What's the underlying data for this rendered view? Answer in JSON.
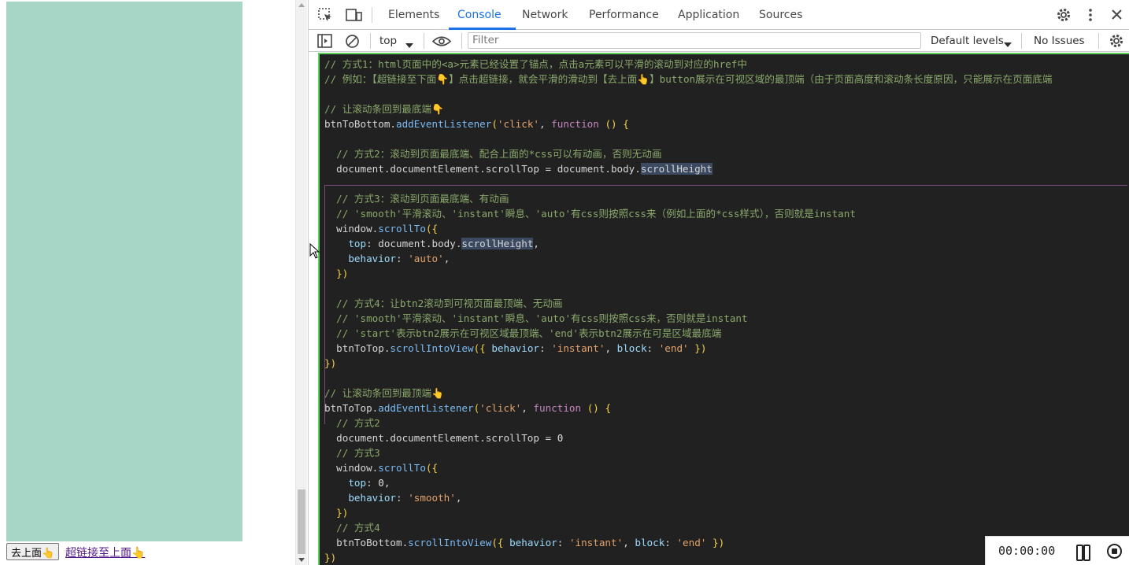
{
  "page": {
    "to_top_button": "去上面👆",
    "link_text": "超链接至上面👆"
  },
  "devtools": {
    "tabs": [
      {
        "label": "Elements"
      },
      {
        "label": "Console"
      },
      {
        "label": "Network"
      },
      {
        "label": "Performance"
      },
      {
        "label": "Application"
      },
      {
        "label": "Sources"
      }
    ],
    "active_tab": "Console",
    "toolbar": {
      "context": "top",
      "filter_placeholder": "Filter",
      "levels": "Default levels",
      "issues": "No Issues"
    },
    "code_lines": [
      "// 方式1：html页面中的<a>元素已经设置了锚点，点击a元素可以平滑的滚动到对应的href中",
      "// 例如：【超链接至下面👇】点击超链接，就会平滑的滑动到【去上面👆】button展示在可视区域的最顶端（由于页面高度和滚动条长度原因，只能展示在页面底端",
      "",
      "// 让滚动条回到最底端👇",
      "btnToBottom.addEventListener('click', function () {",
      "",
      "  // 方式2：滚动到页面最底端、配合上面的*css可以有动画，否则无动画",
      "  document.documentElement.scrollTop = document.body.scrollHeight",
      "",
      "  // 方式3：滚动到页面最底端、有动画",
      "  // 'smooth'平滑滚动、'instant'瞬息、'auto'有css则按照css来（例如上面的*css样式），否则就是instant",
      "  window.scrollTo({",
      "    top: document.body.scrollHeight,",
      "    behavior: 'auto',",
      "  })",
      "",
      "  // 方式4：让btn2滚动到可视页面最顶端、无动画",
      "  // 'smooth'平滑滚动、'instant'瞬息、'auto'有css则按照css来，否则就是instant",
      "  // 'start'表示btn2展示在可视区域最顶端、'end'表示btn2展示在可是区域最底端",
      "  btnToTop.scrollIntoView({ behavior: 'instant', block: 'end' })",
      "})",
      "",
      "// 让滚动条回到最顶端👆",
      "btnToTop.addEventListener('click', function () {",
      "  // 方式2",
      "  document.documentElement.scrollTop = 0",
      "  // 方式3",
      "  window.scrollTo({",
      "    top: 0,",
      "    behavior: 'smooth',",
      "  })",
      "  // 方式4",
      "  btnToBottom.scrollIntoView({ behavior: 'instant', block: 'end' })",
      "})"
    ]
  },
  "recorder": {
    "time": "00:00:00"
  },
  "colors": {
    "page_green": "#a8d6c6",
    "accent": "#1a73e8",
    "console_bg": "#212121",
    "comment": "#8aa86b",
    "string": "#e4a269",
    "keyword": "#c586c0",
    "function": "#7bbcf5"
  }
}
